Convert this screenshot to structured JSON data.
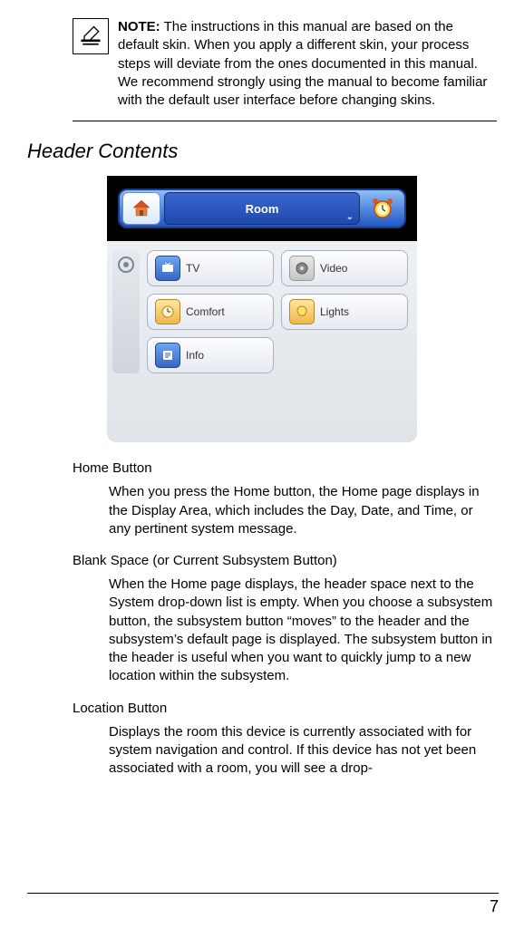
{
  "note": {
    "label": "NOTE:",
    "text": "The instructions in this manual are based on the default skin. When you apply a different skin, your process steps will deviate from the ones documented in this manual. We recommend strongly using the manual to become familiar with the default user interface before changing skins."
  },
  "section_title": "Header Contents",
  "screenshot": {
    "room_label": "Room",
    "buttons": {
      "tv": "TV",
      "video": "Video",
      "comfort": "Comfort",
      "lights": "Lights",
      "info": "Info"
    }
  },
  "subsections": {
    "home": {
      "title": "Home Button",
      "body": "When you press the Home button, the Home page displays in the Display Area, which includes the Day, Date, and Time, or any pertinent system message."
    },
    "blank": {
      "title": "Blank Space (or Current Subsystem Button)",
      "body": "When the Home page displays, the header space next to the System drop-down list is empty. When you choose a subsystem button, the subsystem button “moves” to the header and the subsystem’s default page is displayed. The subsystem button in the header is useful when you want to quickly jump to a new location within the subsystem."
    },
    "location": {
      "title": "Location Button",
      "body": "Displays the room this device is currently associated with for system navigation and control. If this device has not yet been associated with a room, you will see a drop-"
    }
  },
  "page_number": "7"
}
